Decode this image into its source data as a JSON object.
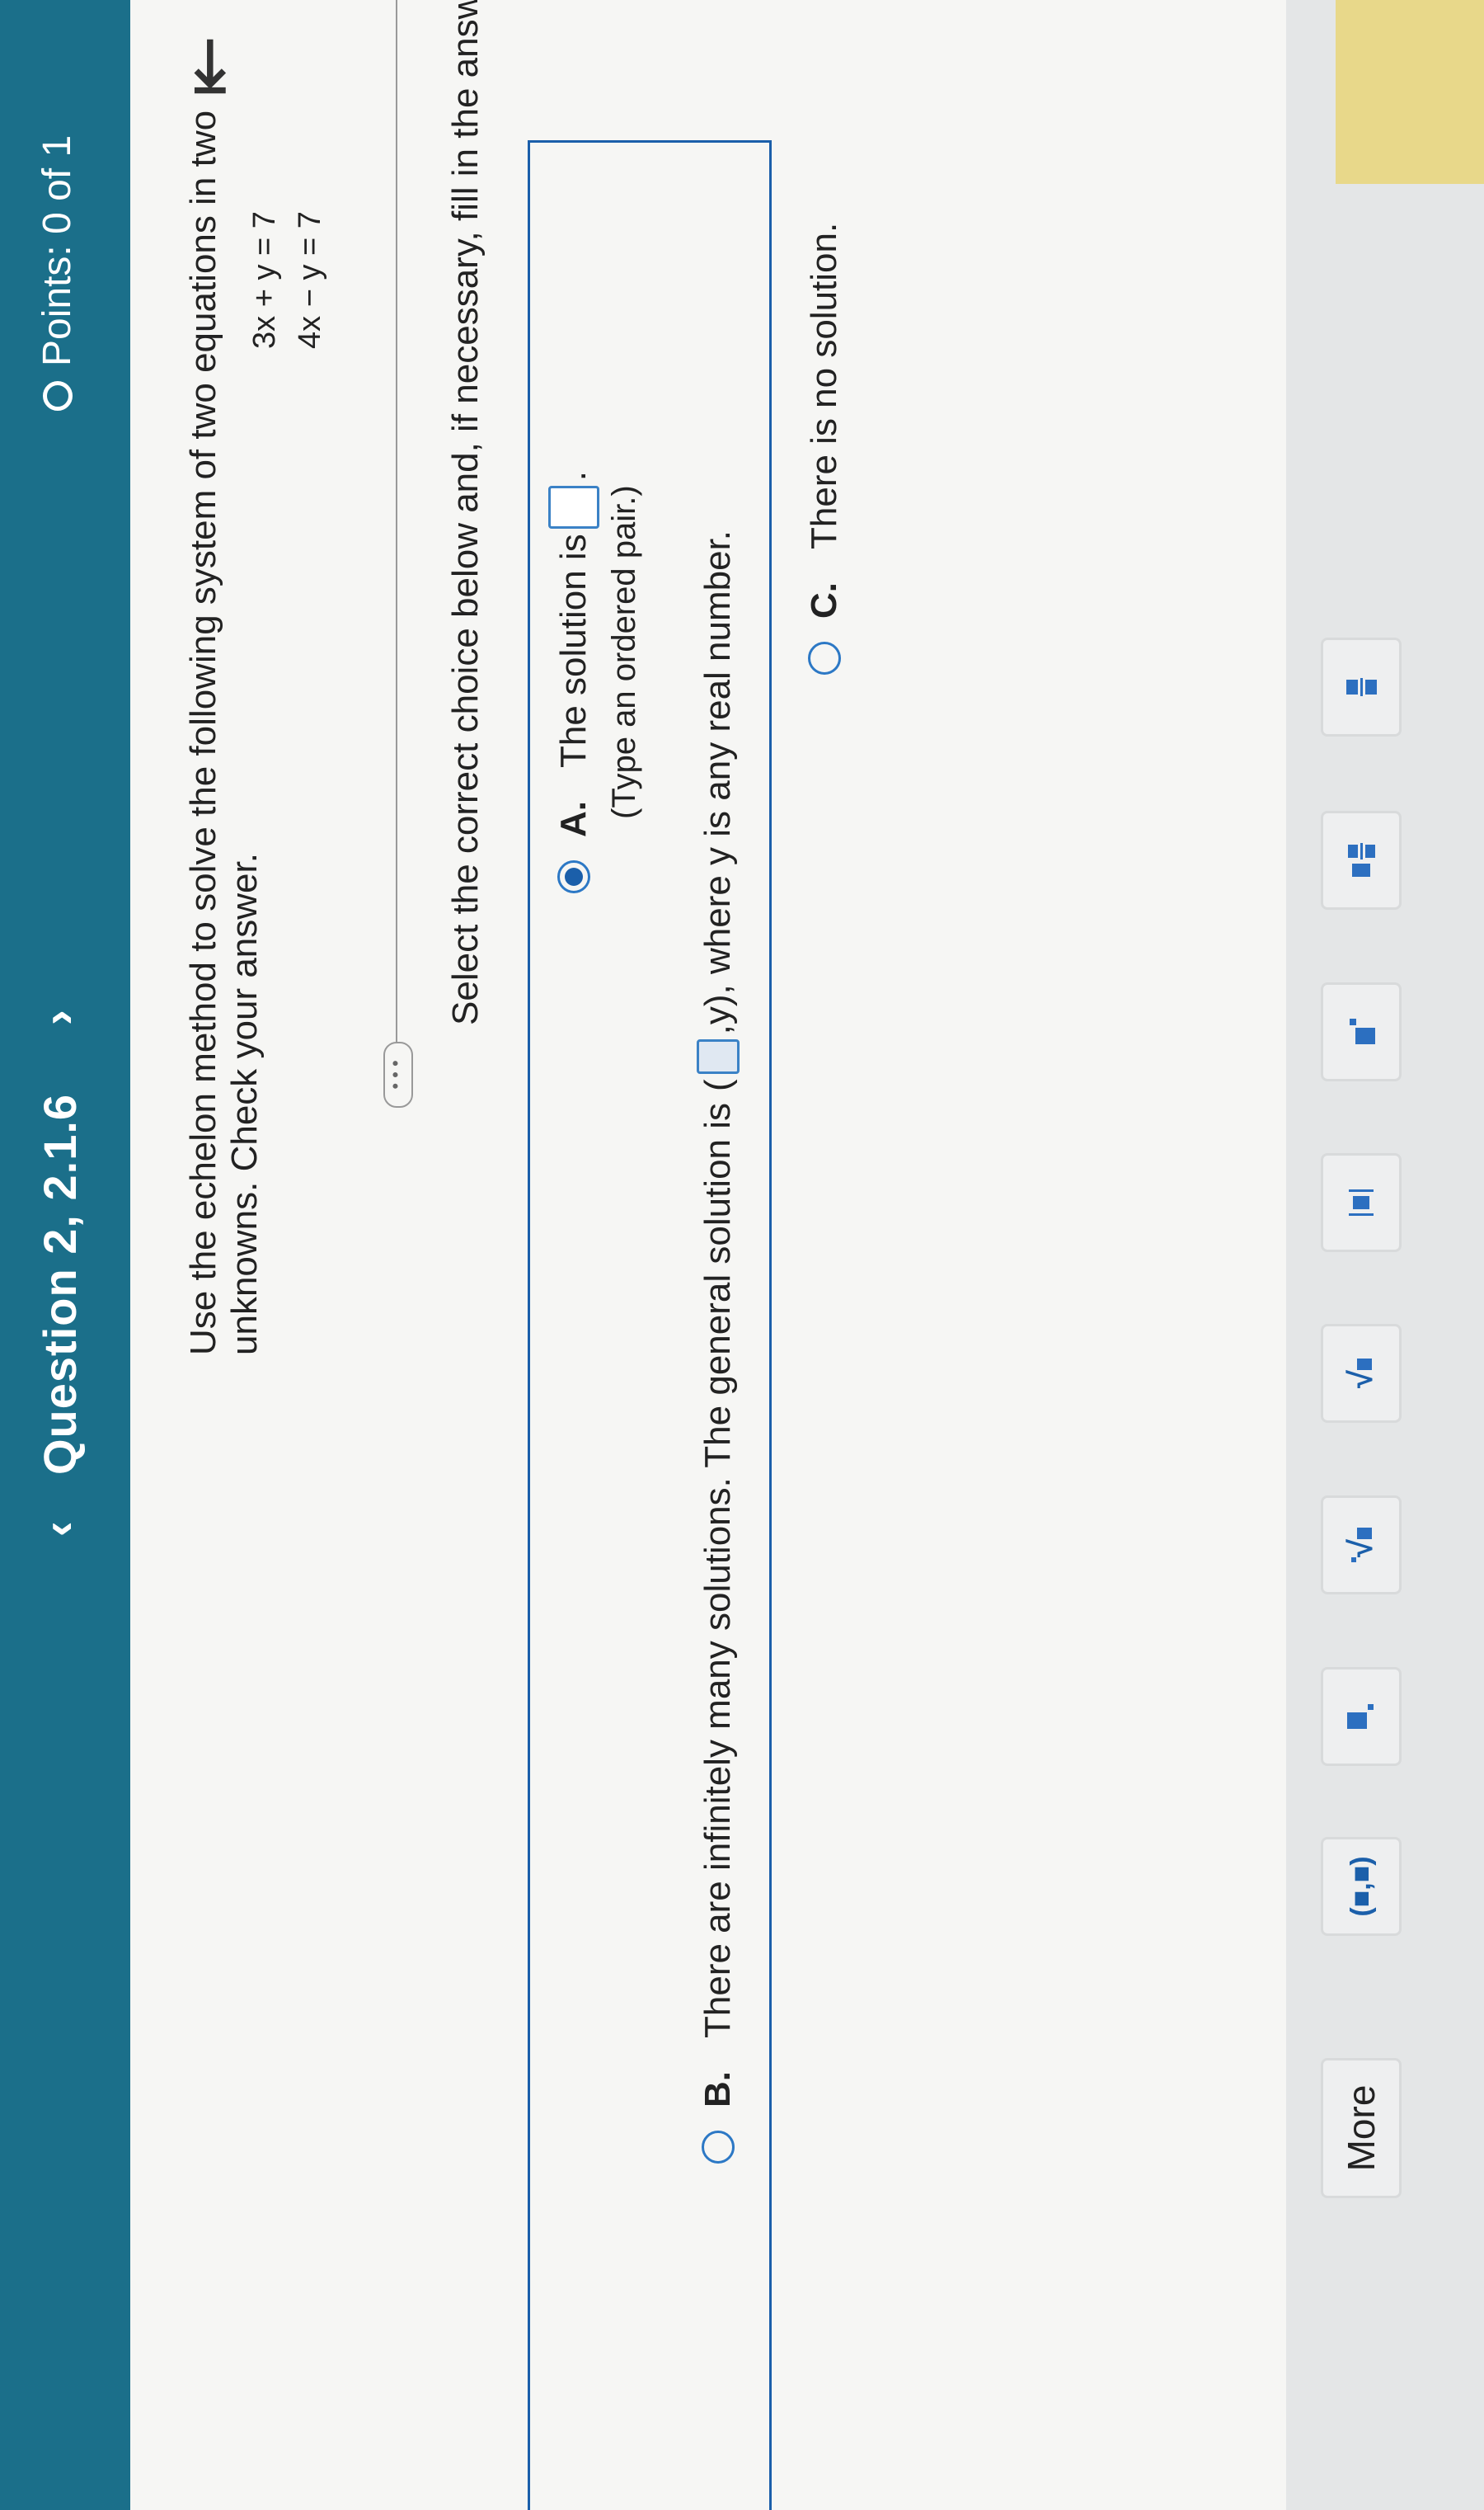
{
  "header": {
    "title": "Question 2, 2.1.6",
    "points": "Points: 0 of 1",
    "prev": "‹",
    "next": "›"
  },
  "problem": {
    "prompt": "Use the echelon method to solve the following system of two equations in two unknowns. Check your answer.",
    "eq1": "3x + y = 7",
    "eq2": "4x − y = 7"
  },
  "instruction": "Select the correct choice below and, if necessary, fill in the answer box to complete your choice.",
  "options": {
    "a": {
      "letter": "A.",
      "text": "The solution is",
      "hint": "(Type an ordered pair.)"
    },
    "b": {
      "letter": "B.",
      "text_pre": "There are infinitely many solutions. The general solution is",
      "text_post": ",y), where y is any real number."
    },
    "c": {
      "letter": "C.",
      "text": "There is no solution."
    }
  },
  "toolbar": {
    "more_label": "More",
    "pair_label": "(■,■)"
  }
}
